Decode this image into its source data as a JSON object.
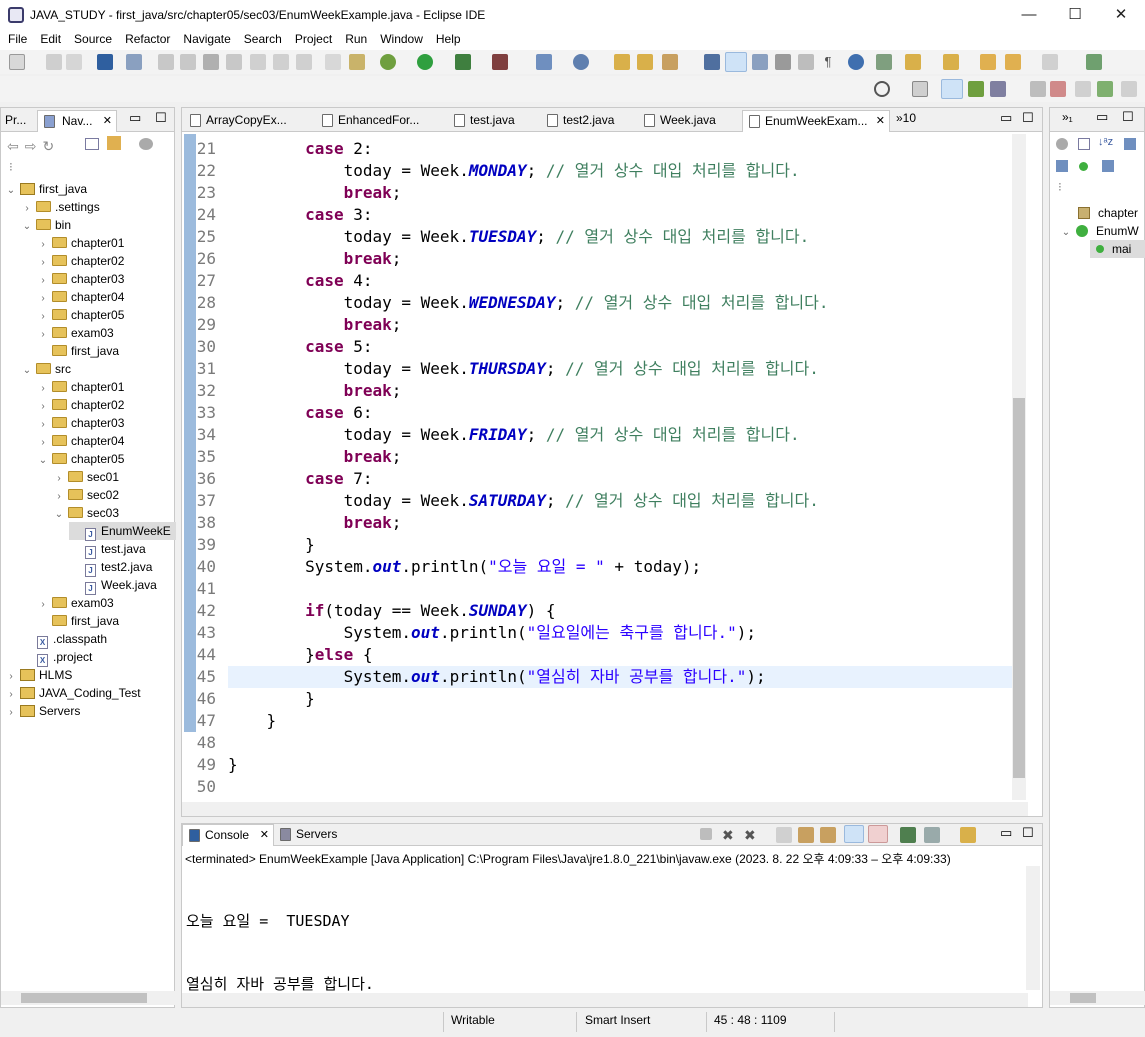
{
  "window": {
    "title": "JAVA_STUDY - first_java/src/chapter05/sec03/EnumWeekExample.java - Eclipse IDE",
    "min": "—",
    "max": "☐",
    "close": "✕"
  },
  "menu": [
    "File",
    "Edit",
    "Source",
    "Refactor",
    "Navigate",
    "Search",
    "Project",
    "Run",
    "Window",
    "Help"
  ],
  "left_panel": {
    "tabs": [
      {
        "label": "Pr..."
      },
      {
        "label": "Nav..."
      }
    ],
    "tree": [
      {
        "label": "first_java",
        "level": 0,
        "kind": "project",
        "open": true
      },
      {
        "label": ".settings",
        "level": 1,
        "kind": "folder",
        "open": false
      },
      {
        "label": "bin",
        "level": 1,
        "kind": "folder",
        "open": true
      },
      {
        "label": "chapter01",
        "level": 2,
        "kind": "folder",
        "open": false
      },
      {
        "label": "chapter02",
        "level": 2,
        "kind": "folder",
        "open": false
      },
      {
        "label": "chapter03",
        "level": 2,
        "kind": "folder",
        "open": false
      },
      {
        "label": "chapter04",
        "level": 2,
        "kind": "folder",
        "open": false
      },
      {
        "label": "chapter05",
        "level": 2,
        "kind": "folder",
        "open": false
      },
      {
        "label": "exam03",
        "level": 2,
        "kind": "folder",
        "open": false
      },
      {
        "label": "first_java",
        "level": 2,
        "kind": "folder",
        "open": null
      },
      {
        "label": "src",
        "level": 1,
        "kind": "folder",
        "open": true
      },
      {
        "label": "chapter01",
        "level": 2,
        "kind": "folder",
        "open": false
      },
      {
        "label": "chapter02",
        "level": 2,
        "kind": "folder",
        "open": false
      },
      {
        "label": "chapter03",
        "level": 2,
        "kind": "folder",
        "open": false
      },
      {
        "label": "chapter04",
        "level": 2,
        "kind": "folder",
        "open": false
      },
      {
        "label": "chapter05",
        "level": 2,
        "kind": "folder",
        "open": true
      },
      {
        "label": "sec01",
        "level": 3,
        "kind": "folder",
        "open": false
      },
      {
        "label": "sec02",
        "level": 3,
        "kind": "folder",
        "open": false
      },
      {
        "label": "sec03",
        "level": 3,
        "kind": "folder",
        "open": true
      },
      {
        "label": "EnumWeekE",
        "level": 4,
        "kind": "java",
        "open": null,
        "selected": true
      },
      {
        "label": "test.java",
        "level": 4,
        "kind": "java",
        "open": null
      },
      {
        "label": "test2.java",
        "level": 4,
        "kind": "java",
        "open": null
      },
      {
        "label": "Week.java",
        "level": 4,
        "kind": "java",
        "open": null
      },
      {
        "label": "exam03",
        "level": 2,
        "kind": "folder",
        "open": false
      },
      {
        "label": "first_java",
        "level": 2,
        "kind": "folder",
        "open": null
      },
      {
        "label": ".classpath",
        "level": 1,
        "kind": "xml",
        "open": null
      },
      {
        "label": ".project",
        "level": 1,
        "kind": "xml",
        "open": null
      },
      {
        "label": "HLMS",
        "level": 0,
        "kind": "project",
        "open": false
      },
      {
        "label": "JAVA_Coding_Test",
        "level": 0,
        "kind": "project",
        "open": false
      },
      {
        "label": "Servers",
        "level": 0,
        "kind": "project",
        "open": false
      }
    ]
  },
  "editor": {
    "tabs": [
      {
        "label": "ArrayCopyEx..."
      },
      {
        "label": "EnhancedFor..."
      },
      {
        "label": "test.java"
      },
      {
        "label": "test2.java"
      },
      {
        "label": "Week.java"
      },
      {
        "label": "EnumWeekExam...",
        "active": true
      }
    ],
    "overflow": "»10",
    "lines": [
      {
        "n": "21",
        "code": "        <span class='kw'>case</span> 2:"
      },
      {
        "n": "22",
        "code": "            today = Week.<span class='en'>MONDAY</span>; <span class='cm'>// 열거 상수 대입 처리를 합니다.</span>"
      },
      {
        "n": "23",
        "code": "            <span class='kw'>break</span>;"
      },
      {
        "n": "24",
        "code": "        <span class='kw'>case</span> 3:"
      },
      {
        "n": "25",
        "code": "            today = Week.<span class='en'>TUESDAY</span>; <span class='cm'>// 열거 상수 대입 처리를 합니다.</span>"
      },
      {
        "n": "26",
        "code": "            <span class='kw'>break</span>;"
      },
      {
        "n": "27",
        "code": "        <span class='kw'>case</span> 4:"
      },
      {
        "n": "28",
        "code": "            today = Week.<span class='en'>WEDNESDAY</span>; <span class='cm'>// 열거 상수 대입 처리를 합니다.</span>"
      },
      {
        "n": "29",
        "code": "            <span class='kw'>break</span>;"
      },
      {
        "n": "30",
        "code": "        <span class='kw'>case</span> 5:"
      },
      {
        "n": "31",
        "code": "            today = Week.<span class='en'>THURSDAY</span>; <span class='cm'>// 열거 상수 대입 처리를 합니다.</span>"
      },
      {
        "n": "32",
        "code": "            <span class='kw'>break</span>;"
      },
      {
        "n": "33",
        "code": "        <span class='kw'>case</span> 6:"
      },
      {
        "n": "34",
        "code": "            today = Week.<span class='en'>FRIDAY</span>; <span class='cm'>// 열거 상수 대입 처리를 합니다.</span>"
      },
      {
        "n": "35",
        "code": "            <span class='kw'>break</span>;"
      },
      {
        "n": "36",
        "code": "        <span class='kw'>case</span> 7:"
      },
      {
        "n": "37",
        "code": "            today = Week.<span class='en'>SATURDAY</span>; <span class='cm'>// 열거 상수 대입 처리를 합니다.</span>"
      },
      {
        "n": "38",
        "code": "            <span class='kw'>break</span>;"
      },
      {
        "n": "39",
        "code": "        }"
      },
      {
        "n": "40",
        "code": "        System.<span class='fd'>out</span>.println(<span class='st'>\"오늘 요일 = \"</span> + today);"
      },
      {
        "n": "41",
        "code": ""
      },
      {
        "n": "42",
        "code": "        <span class='kw'>if</span>(today == Week.<span class='en'>SUNDAY</span>) {"
      },
      {
        "n": "43",
        "code": "            System.<span class='fd'>out</span>.println(<span class='st'>\"일요일에는 축구를 합니다.\"</span>);"
      },
      {
        "n": "44",
        "code": "        }<span class='kw'>else</span> {"
      },
      {
        "n": "45",
        "code": "            System.<span class='fd'>out</span>.println(<span class='st'>\"열심히 자바 공부를 합니다.\"</span>);",
        "current": true
      },
      {
        "n": "46",
        "code": "        }"
      },
      {
        "n": "47",
        "code": "    }"
      },
      {
        "n": "48",
        "code": ""
      },
      {
        "n": "49",
        "code": "}"
      },
      {
        "n": "50",
        "code": ""
      }
    ]
  },
  "outline": {
    "items": [
      {
        "label": "chapter"
      },
      {
        "label": "EnumW"
      },
      {
        "label": "mai"
      }
    ]
  },
  "console": {
    "tabs": [
      {
        "label": "Console"
      },
      {
        "label": "Servers"
      }
    ],
    "header": "<terminated> EnumWeekExample [Java Application] C:\\Program Files\\Java\\jre1.8.0_221\\bin\\javaw.exe  (2023. 8. 22 오후 4:09:33 – 오후 4:09:33)",
    "output": [
      "오늘 요일 =  TUESDAY",
      "열심히 자바 공부를 합니다."
    ]
  },
  "status": {
    "writable": "Writable",
    "insert": "Smart Insert",
    "position": "45 : 48 : 1109"
  },
  "colors": {
    "accent": "#4b83c1",
    "keyword": "#7f0055",
    "enum": "#0000c0",
    "comment": "#3f7f5f",
    "string": "#2a00ff",
    "current_line": "#e8f2fe"
  }
}
